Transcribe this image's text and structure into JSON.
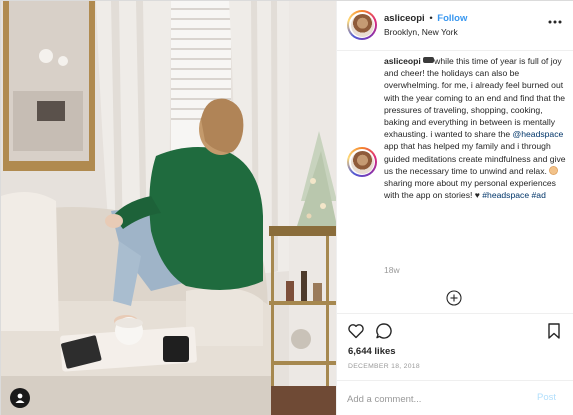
{
  "colors": {
    "accent": "#3897f0",
    "link": "#003569",
    "muted": "#999999",
    "text": "#262626",
    "post_disabled": "#b2dffc"
  },
  "photo": {
    "alt_icon": "user-silhouette-icon"
  },
  "header": {
    "username": "asliceopi",
    "separator": "•",
    "follow_label": "Follow",
    "location": "Brooklyn, New York",
    "more_icon": "more-horizontal-icon"
  },
  "caption": {
    "username": "asliceopi",
    "text_1": "while this time of year is full of joy and cheer! the holidays can also be overwhelming. for me, i already feel burned out with the year coming to an end and find that the pressures of traveling, shopping, cooking, baking and everything in between is mentally exhausting. i wanted to share the",
    "mention": "@headspace",
    "text_2": "app that has helped my family and i through guided meditations create mindfulness and give us the necessary time to unwind and relax.",
    "text_3": "sharing more about my personal experiences with the app on stories!",
    "heart": "♥",
    "hashtag_1": "#headspace",
    "hashtag_2": "#ad",
    "time_ago": "18w"
  },
  "load_more_icon": "plus-circle-icon",
  "actions": {
    "like_icon": "heart-icon",
    "comment_icon": "comment-icon",
    "save_icon": "bookmark-icon"
  },
  "likes": "6,644 likes",
  "date": "DECEMBER 18, 2018",
  "comment": {
    "placeholder": "Add a comment...",
    "post_label": "Post"
  }
}
